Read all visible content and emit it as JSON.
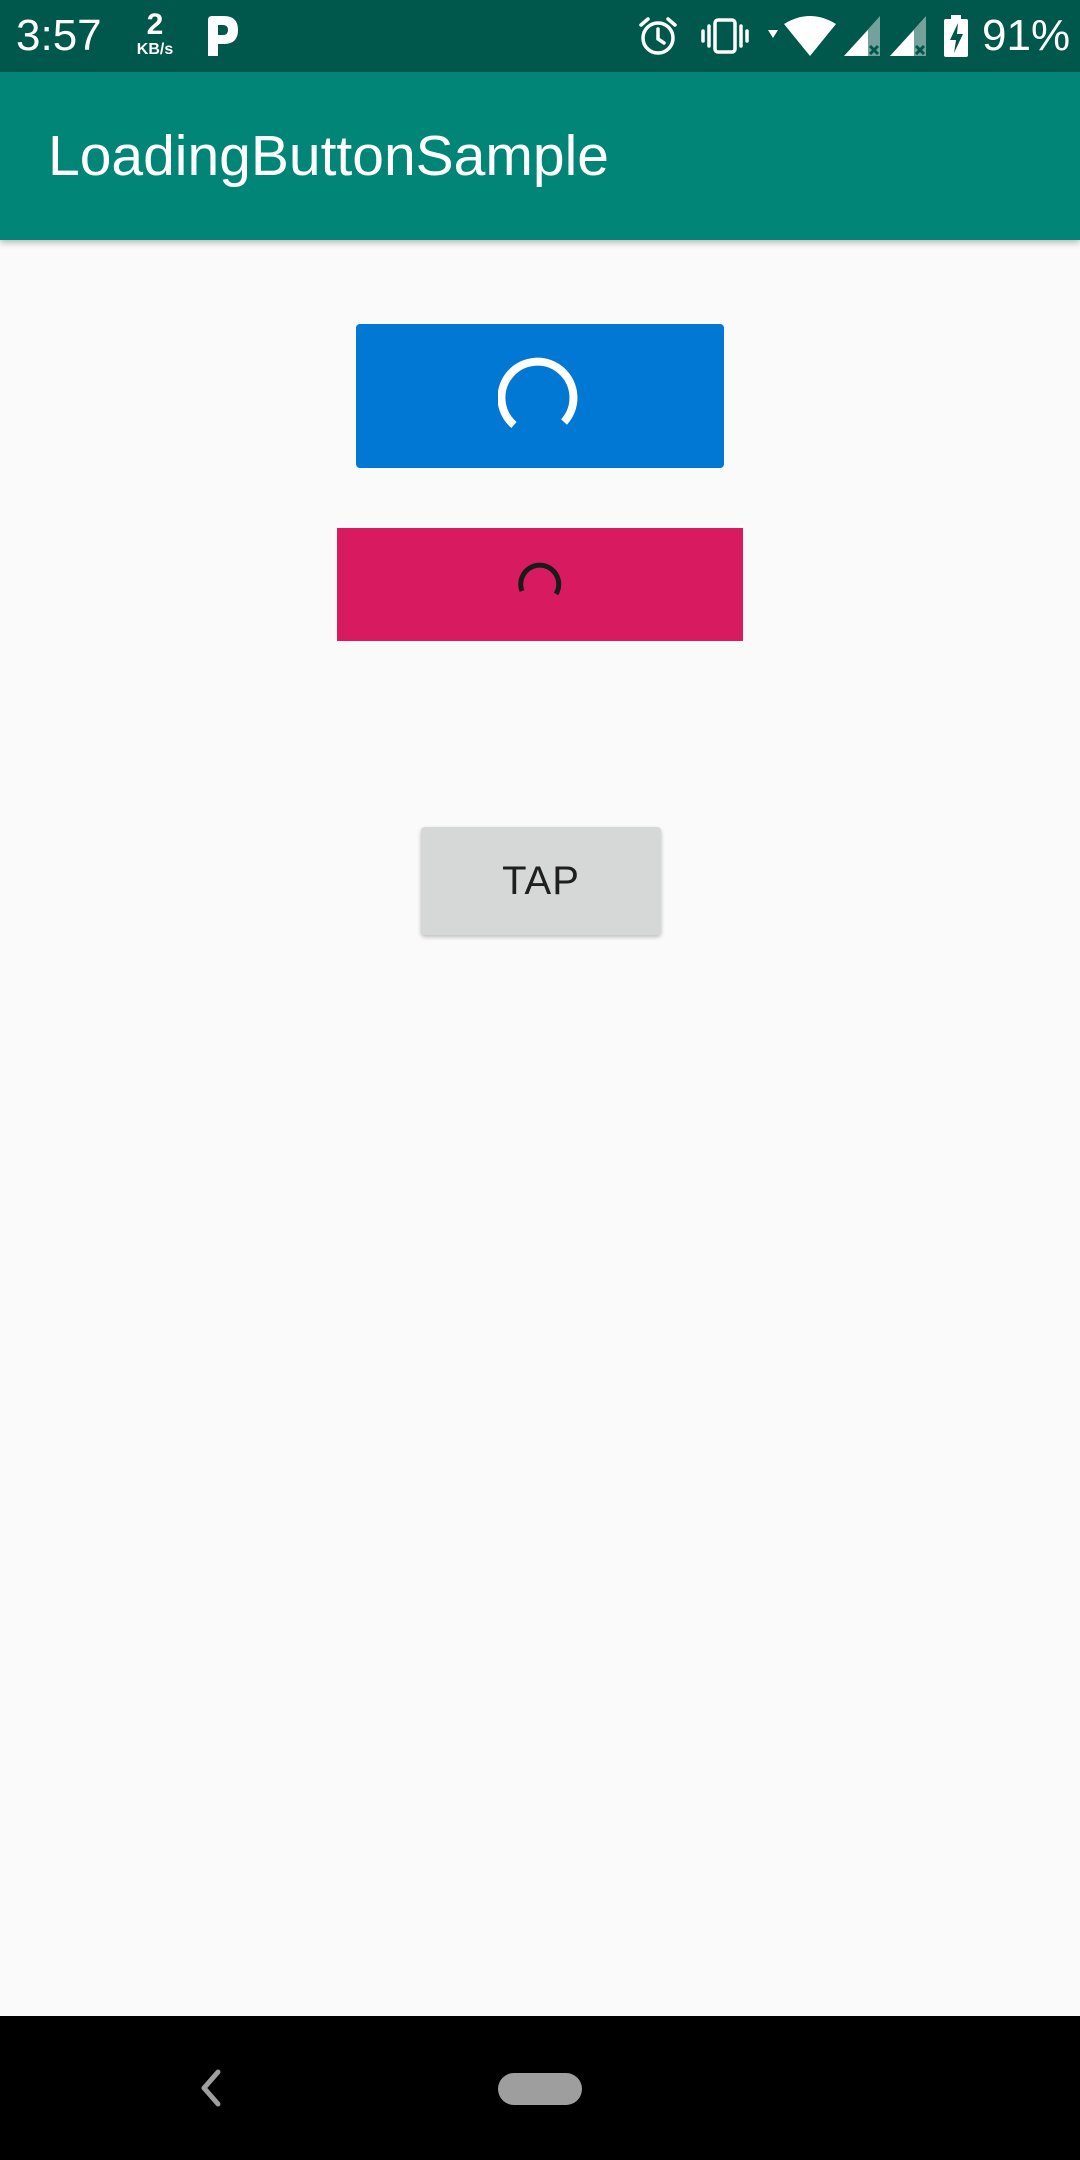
{
  "status_bar": {
    "time": "3:57",
    "speed_value": "2",
    "speed_unit": "KB/s",
    "battery_percent": "91%",
    "icons": [
      "p-app-icon",
      "alarm-icon",
      "vibrate-icon",
      "wifi-icon",
      "signal-icon",
      "signal-icon",
      "battery-charging-icon"
    ]
  },
  "app_bar": {
    "title": "LoadingButtonSample"
  },
  "content": {
    "loading_button_primary": {
      "color": "#0078d4",
      "spinner_color": "#ffffff",
      "icon": "loading-spinner-icon"
    },
    "loading_button_secondary": {
      "color": "#d81b60",
      "spinner_color": "#1a1a1a",
      "icon": "loading-spinner-icon"
    },
    "tap_button_label": "TAP"
  },
  "nav_bar": {
    "icons": [
      "back-icon",
      "home-pill-icon"
    ]
  },
  "colors": {
    "status_bar": "#00574b",
    "app_bar": "#008577",
    "background": "#fafafa"
  }
}
